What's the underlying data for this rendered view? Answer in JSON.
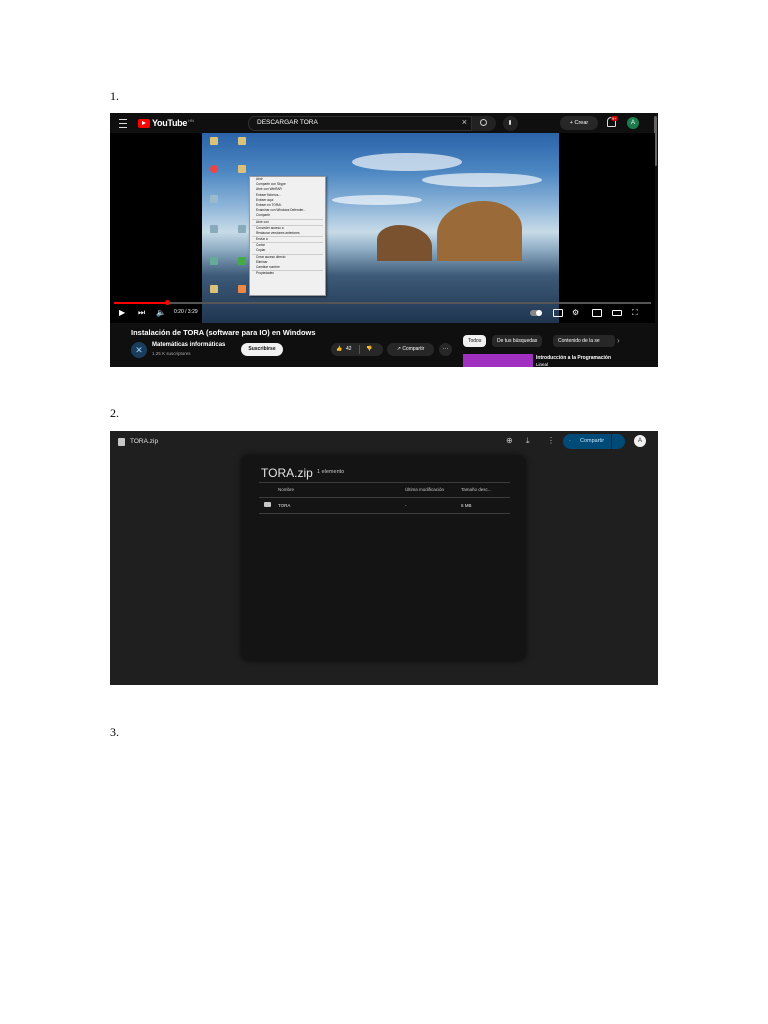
{
  "steps": [
    "1.",
    "2.",
    "3."
  ],
  "youtube": {
    "logo_text": "YouTube",
    "country_code": "HN",
    "search_query": "DESCARGAR TORA",
    "create_label": "Crear",
    "notification_count": "9+",
    "avatar_letter": "A",
    "context_menu": [
      "Abrir",
      "Compartir con Skype",
      "Abrir con WinRAR",
      "Extraer ficheros...",
      "Extraer aquí",
      "Extraer en TORA\\",
      "Examinar con Windows Defender...",
      "Compartir",
      "Abrir con",
      "Conceder acceso a",
      "Restaurar versiones anteriores",
      "Enviar a",
      "Cortar",
      "Copiar",
      "Crear acceso directo",
      "Eliminar",
      "Cambiar nombre",
      "Propiedades"
    ],
    "time": "0:20 / 3:29",
    "progress_fraction": 0.1,
    "video_title": "Instalación de TORA (software para IO) en Windows",
    "channel_name": "Matemáticas informáticas",
    "subscribers": "1.25 K suscriptores",
    "subscribe_label": "Suscribirse",
    "like_count": "42",
    "share_label": "Compartir",
    "chips": [
      "Todos",
      "De tus búsquedas",
      "Contenido de la se"
    ],
    "recommended_title": "Introducción a la Programación",
    "recommended_sub": "Lineal"
  },
  "drive": {
    "file_name": "TORA.zip",
    "share_label": "Compartir",
    "avatar_letter": "A",
    "panel_title": "TORA.zip",
    "item_count": "1 elemento",
    "columns": [
      "Nombre",
      "Última modificación",
      "Tamaño desc..."
    ],
    "rows": [
      {
        "name": "TORA",
        "modified": "-",
        "size": "6 MB"
      }
    ]
  }
}
